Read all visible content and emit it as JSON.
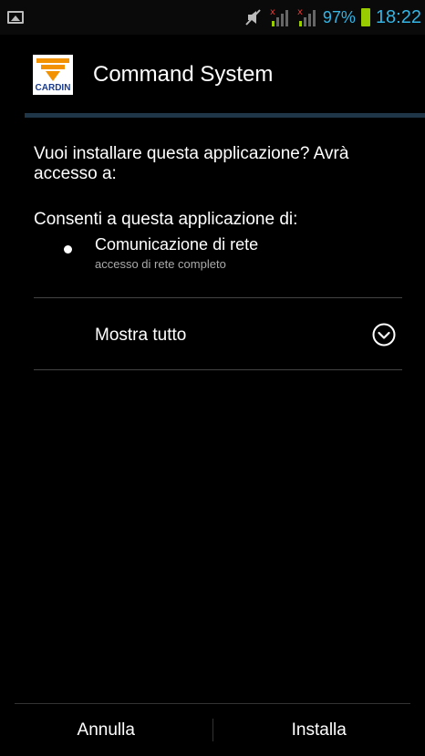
{
  "status_bar": {
    "battery_percent": "97%",
    "time": "18:22",
    "icons": [
      "picture-icon",
      "mute-icon",
      "signal-1-icon",
      "signal-2-icon",
      "battery-icon"
    ]
  },
  "header": {
    "logo_text": "CARDIN",
    "title": "Command System"
  },
  "body": {
    "question": "Vuoi installare questa applicazione? Avrà accesso a:",
    "consent_heading": "Consenti a questa applicazione di:",
    "permissions": [
      {
        "title": "Comunicazione di rete",
        "description": "accesso di rete completo"
      }
    ],
    "show_all_label": "Mostra tutto"
  },
  "buttons": {
    "cancel": "Annulla",
    "install": "Installa"
  },
  "colors": {
    "accent": "#33b5e5",
    "battery": "#99cc00",
    "header_divider": "#1e3648",
    "logo_orange": "#f39200",
    "logo_blue": "#1b3b8a"
  }
}
